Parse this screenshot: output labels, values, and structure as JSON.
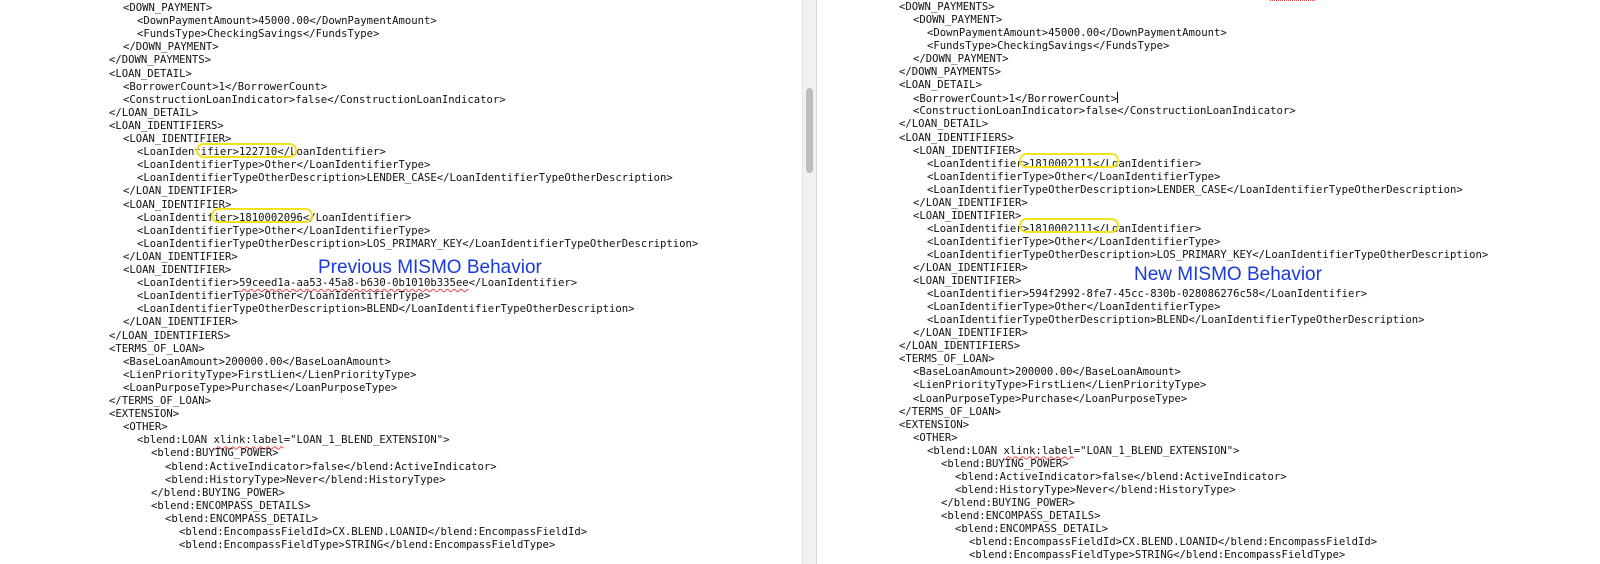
{
  "left": {
    "caption": "Previous MISMO Behavior",
    "lines": [
      {
        "indent": 4,
        "text": "<DOWN_PAYMENT>"
      },
      {
        "indent": 6,
        "text": "<DownPaymentAmount>45000.00</DownPaymentAmount>"
      },
      {
        "indent": 6,
        "text": "<FundsType>CheckingSavings</FundsType>"
      },
      {
        "indent": 4,
        "text": "</DOWN_PAYMENT>"
      },
      {
        "indent": 2,
        "text": "</DOWN_PAYMENTS>"
      },
      {
        "indent": 2,
        "text": "<LOAN_DETAIL>"
      },
      {
        "indent": 4,
        "text": "<BorrowerCount>1</BorrowerCount>"
      },
      {
        "indent": 4,
        "text": "<ConstructionLoanIndicator>false</ConstructionLoanIndicator>"
      },
      {
        "indent": 2,
        "text": "</LOAN_DETAIL>"
      },
      {
        "indent": 2,
        "text": "<LOAN_IDENTIFIERS>"
      },
      {
        "indent": 4,
        "text": "<LOAN_IDENTIFIER>"
      },
      {
        "indent": 6,
        "text": "<LoanIdentifier>122710</LoanIdentifier>"
      },
      {
        "indent": 6,
        "text": "<LoanIdentifierType>Other</LoanIdentifierType>"
      },
      {
        "indent": 6,
        "text": "<LoanIdentifierTypeOtherDescription>LENDER_CASE</LoanIdentifierTypeOtherDescription>"
      },
      {
        "indent": 4,
        "text": "</LOAN_IDENTIFIER>"
      },
      {
        "indent": 4,
        "text": "<LOAN_IDENTIFIER>"
      },
      {
        "indent": 6,
        "text": "<LoanIdentifier>1810002096</LoanIdentifier>"
      },
      {
        "indent": 6,
        "text": "<LoanIdentifierType>Other</LoanIdentifierType>"
      },
      {
        "indent": 6,
        "text": "<LoanIdentifierTypeOtherDescription>LOS_PRIMARY_KEY</LoanIdentifierTypeOtherDescription>"
      },
      {
        "indent": 4,
        "text": "</LOAN_IDENTIFIER>"
      },
      {
        "indent": 4,
        "text": "<LOAN_IDENTIFIER>"
      },
      {
        "indent": 6,
        "pre": "<LoanIdentifier>",
        "squiggle": "59ceed1a-aa53-45a8-b630-0b1010b335ee",
        "post": "</LoanIdentifier>"
      },
      {
        "indent": 6,
        "text": "<LoanIdentifierType>Other</LoanIdentifierType>"
      },
      {
        "indent": 6,
        "text": "<LoanIdentifierTypeOtherDescription>BLEND</LoanIdentifierTypeOtherDescription>"
      },
      {
        "indent": 4,
        "text": "</LOAN_IDENTIFIER>"
      },
      {
        "indent": 2,
        "text": "</LOAN_IDENTIFIERS>"
      },
      {
        "indent": 2,
        "text": "<TERMS_OF_LOAN>"
      },
      {
        "indent": 4,
        "text": "<BaseLoanAmount>200000.00</BaseLoanAmount>"
      },
      {
        "indent": 4,
        "text": "<LienPriorityType>FirstLien</LienPriorityType>"
      },
      {
        "indent": 4,
        "text": "<LoanPurposeType>Purchase</LoanPurposeType>"
      },
      {
        "indent": 2,
        "text": "</TERMS_OF_LOAN>"
      },
      {
        "indent": 2,
        "text": "<EXTENSION>"
      },
      {
        "indent": 4,
        "text": "<OTHER>"
      },
      {
        "indent": 6,
        "pre": "<blend:LOAN ",
        "squiggle": "xlink:label",
        "post": "=\"LOAN_1_BLEND_EXTENSION\">"
      },
      {
        "indent": 8,
        "text": "<blend:BUYING_POWER>"
      },
      {
        "indent": 10,
        "text": "<blend:ActiveIndicator>false</blend:ActiveIndicator>"
      },
      {
        "indent": 10,
        "text": "<blend:HistoryType>Never</blend:HistoryType>"
      },
      {
        "indent": 8,
        "text": "</blend:BUYING_POWER>"
      },
      {
        "indent": 8,
        "text": "<blend:ENCOMPASS_DETAILS>"
      },
      {
        "indent": 10,
        "text": "<blend:ENCOMPASS_DETAIL>"
      },
      {
        "indent": 12,
        "text": "<blend:EncompassFieldId>CX.BLEND.LOANID</blend:EncompassFieldId>"
      },
      {
        "indent": 12,
        "text": "<blend:EncompassFieldType>STRING</blend:EncompassFieldType>"
      }
    ]
  },
  "right": {
    "caption": "New MISMO Behavior",
    "lines": [
      {
        "indent": 0,
        "text": "<DOWN_PAYMENTS>"
      },
      {
        "indent": 2,
        "text": "<DOWN_PAYMENT>"
      },
      {
        "indent": 4,
        "text": "<DownPaymentAmount>45000.00</DownPaymentAmount>"
      },
      {
        "indent": 4,
        "text": "<FundsType>CheckingSavings</FundsType>"
      },
      {
        "indent": 2,
        "text": "</DOWN_PAYMENT>"
      },
      {
        "indent": 0,
        "text": "</DOWN_PAYMENTS>"
      },
      {
        "indent": 0,
        "text": "<LOAN_DETAIL>"
      },
      {
        "indent": 2,
        "text": "<BorrowerCount>1</BorrowerCount>",
        "cursor": true
      },
      {
        "indent": 2,
        "text": "<ConstructionLoanIndicator>false</ConstructionLoanIndicator>"
      },
      {
        "indent": 0,
        "text": "</LOAN_DETAIL>"
      },
      {
        "indent": 0,
        "text": "<LOAN_IDENTIFIERS>"
      },
      {
        "indent": 2,
        "text": "<LOAN_IDENTIFIER>"
      },
      {
        "indent": 4,
        "text": "<LoanIdentifier>1810002111</LoanIdentifier>"
      },
      {
        "indent": 4,
        "text": "<LoanIdentifierType>Other</LoanIdentifierType>"
      },
      {
        "indent": 4,
        "text": "<LoanIdentifierTypeOtherDescription>LENDER_CASE</LoanIdentifierTypeOtherDescription>"
      },
      {
        "indent": 2,
        "text": "</LOAN_IDENTIFIER>"
      },
      {
        "indent": 2,
        "text": "<LOAN_IDENTIFIER>"
      },
      {
        "indent": 4,
        "text": "<LoanIdentifier>1810002111</LoanIdentifier>"
      },
      {
        "indent": 4,
        "text": "<LoanIdentifierType>Other</LoanIdentifierType>"
      },
      {
        "indent": 4,
        "text": "<LoanIdentifierTypeOtherDescription>LOS_PRIMARY_KEY</LoanIdentifierTypeOtherDescription>"
      },
      {
        "indent": 2,
        "text": "</LOAN_IDENTIFIER>"
      },
      {
        "indent": 2,
        "text": "<LOAN_IDENTIFIER>"
      },
      {
        "indent": 4,
        "text": "<LoanIdentifier>594f2992-8fe7-45cc-830b-028086276c58</LoanIdentifier>"
      },
      {
        "indent": 4,
        "text": "<LoanIdentifierType>Other</LoanIdentifierType>"
      },
      {
        "indent": 4,
        "text": "<LoanIdentifierTypeOtherDescription>BLEND</LoanIdentifierTypeOtherDescription>"
      },
      {
        "indent": 2,
        "text": "</LOAN_IDENTIFIER>"
      },
      {
        "indent": 0,
        "text": "</LOAN_IDENTIFIERS>"
      },
      {
        "indent": 0,
        "text": "<TERMS_OF_LOAN>"
      },
      {
        "indent": 2,
        "text": "<BaseLoanAmount>200000.00</BaseLoanAmount>"
      },
      {
        "indent": 2,
        "text": "<LienPriorityType>FirstLien</LienPriorityType>"
      },
      {
        "indent": 2,
        "text": "<LoanPurposeType>Purchase</LoanPurposeType>"
      },
      {
        "indent": 0,
        "text": "</TERMS_OF_LOAN>"
      },
      {
        "indent": 0,
        "text": "<EXTENSION>"
      },
      {
        "indent": 2,
        "text": "<OTHER>"
      },
      {
        "indent": 4,
        "pre": "<blend:LOAN ",
        "squiggle": "xlink:label",
        "post": "=\"LOAN_1_BLEND_EXTENSION\">"
      },
      {
        "indent": 6,
        "text": "<blend:BUYING_POWER>"
      },
      {
        "indent": 8,
        "text": "<blend:ActiveIndicator>false</blend:ActiveIndicator>"
      },
      {
        "indent": 8,
        "text": "<blend:HistoryType>Never</blend:HistoryType>"
      },
      {
        "indent": 6,
        "text": "</blend:BUYING_POWER>"
      },
      {
        "indent": 6,
        "text": "<blend:ENCOMPASS_DETAILS>"
      },
      {
        "indent": 8,
        "text": "<blend:ENCOMPASS_DETAIL>"
      },
      {
        "indent": 10,
        "text": "<blend:EncompassFieldId>CX.BLEND.LOANID</blend:EncompassFieldId>"
      },
      {
        "indent": 10,
        "text": "<blend:EncompassFieldType>STRING</blend:EncompassFieldType>"
      }
    ]
  },
  "colors": {
    "caption": "#1a3bdc",
    "highlight": "#f3e31c",
    "squiggle": "#e44"
  }
}
